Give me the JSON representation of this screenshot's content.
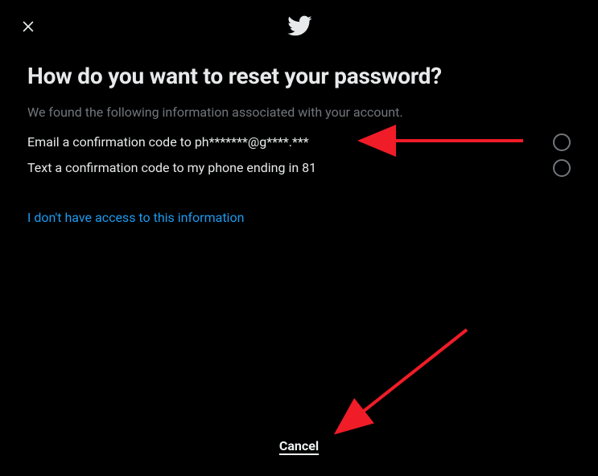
{
  "header": {
    "close_icon": "close",
    "logo": "twitter-bird"
  },
  "title": "How do you want to reset your password?",
  "subtitle": "We found the following information associated with your account.",
  "options": [
    {
      "label": "Email a confirmation code to ph*******@g****.***"
    },
    {
      "label": "Text a confirmation code to my phone ending in 81"
    }
  ],
  "no_access_label": "I don't have access to this information",
  "cancel_label": "Cancel"
}
